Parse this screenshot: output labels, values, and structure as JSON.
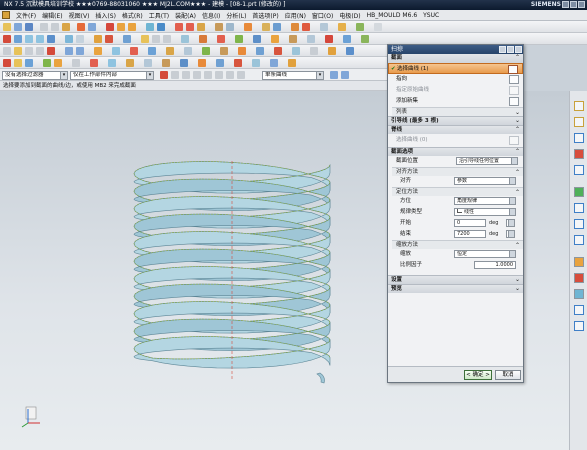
{
  "titlebar": {
    "text": "NX 7.5 沉默模具培训学校 ★★★0769-88031060 ★★★ MJ2L.COM★★★ - 建模 - [08-1.prt (修改的) ]",
    "brand": "SIEMENS"
  },
  "menubar": {
    "items": [
      "文件(F)",
      "编辑(E)",
      "视图(V)",
      "插入(S)",
      "格式(R)",
      "工具(T)",
      "装配(A)",
      "信息(I)",
      "分析(L)",
      "首选项(P)",
      "应用(N)",
      "窗口(O)",
      "电极(D)",
      "HB_MOULD M6.6",
      "YSUC"
    ]
  },
  "selection_bar": {
    "filter": "没有选择过滤器",
    "scope": "仅在工作部件内部",
    "curve_rule": "单条曲线"
  },
  "cue_line": "选择要添加到截面的曲线/边，或使用 MB2 来完成截面",
  "colors": {
    "ribbon_face": "#9fc6d6",
    "ribbon_shadow": "#5d8696",
    "guide_line": "#7ea23a",
    "highlight": "#e89b4c"
  },
  "dialog": {
    "title": "扫掠",
    "sections": {
      "section": "截面",
      "guides": "引导线 (最多 3 根)",
      "spine": "脊线",
      "options": "截面选项",
      "settings": "设置",
      "preview": "预览"
    },
    "select_curve": "选择曲线 (1)",
    "select_curve_badge": "✔",
    "direction": "指向",
    "specify_origin": "指定原始曲线",
    "add_new_set": "添加新集",
    "list": "列表",
    "spine_select": "选择曲线 (0)",
    "section_position_label": "截面位置",
    "section_position_value": "沿引导线任何位置",
    "alignment_method": "对齐方法",
    "alignment_label": "对齐",
    "alignment_value": "参数",
    "orientation_method": "定位方法",
    "orientation_label": "方位",
    "orientation_value": "角度规律",
    "law_type_label": "规律类型",
    "law_type_value": "线性",
    "start_label": "开始",
    "start_value": "0",
    "end_label": "结束",
    "end_value": "7200",
    "unit": "deg",
    "scaling_method": "缩放方法",
    "scaling_label": "缩放",
    "scaling_value": "恒定",
    "scale_factor_label": "比例因子",
    "scale_factor_value": "1.0000",
    "ok": "< 确定 >",
    "cancel": "取消"
  }
}
